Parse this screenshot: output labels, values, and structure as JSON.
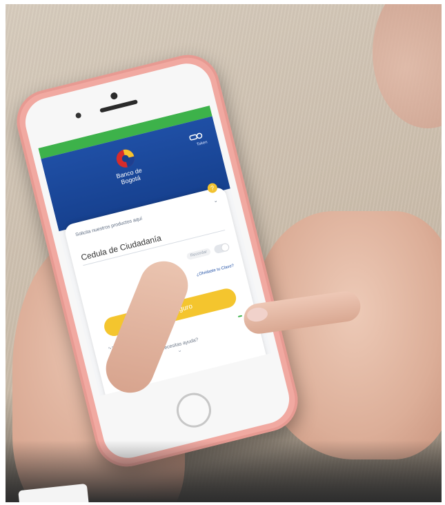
{
  "scene": {
    "description_colors": {
      "table": "#cdbfae",
      "phone_case": "#f1a9a1",
      "skin": "#dcae98"
    }
  },
  "phone_screen": {
    "status_left": "",
    "status_right": "",
    "bank_name_line1": "Banco de",
    "bank_name_line2": "Bogotá",
    "token_label": "Token",
    "prompt": "Solicita nuestros productos aquí",
    "id_type": "Cedula de Ciudadanía",
    "remember_label": "Recordar",
    "forgot_password": "¿Olvidaste tu Clave?",
    "login_button": "Ingresa seguro",
    "contact": "¿Necesitas ayuda?",
    "badge": "",
    "colors": {
      "status_green": "#3db24a",
      "header_blue": "#1f4fa5",
      "button_yellow": "#f4c52e"
    }
  }
}
